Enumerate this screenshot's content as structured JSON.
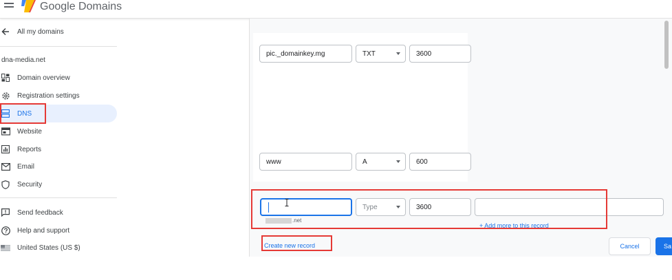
{
  "header": {
    "brand": "Google Domains"
  },
  "sidebar": {
    "back_label": "All my domains",
    "domain": "dna-media.net",
    "items": [
      {
        "label": "Domain overview",
        "icon": "dashboard-icon"
      },
      {
        "label": "Registration settings",
        "icon": "gear-icon"
      },
      {
        "label": "DNS",
        "icon": "dns-icon",
        "active": true
      },
      {
        "label": "Website",
        "icon": "website-icon"
      },
      {
        "label": "Reports",
        "icon": "reports-icon"
      },
      {
        "label": "Email",
        "icon": "email-icon"
      },
      {
        "label": "Security",
        "icon": "shield-icon"
      }
    ],
    "footer": [
      {
        "label": "Send feedback",
        "icon": "feedback-icon"
      },
      {
        "label": "Help and support",
        "icon": "help-icon"
      },
      {
        "label": "United States (US $)",
        "icon": "us-flag-icon"
      }
    ]
  },
  "records": [
    {
      "host": "pic._domainkey.mg",
      "type": "TXT",
      "ttl": "3600"
    },
    {
      "host": "www",
      "type": "A",
      "ttl": "600"
    }
  ],
  "new_record": {
    "host_value": "",
    "type_placeholder": "Type",
    "ttl": "3600",
    "data_value": "",
    "suggestion_suffix": ".net",
    "add_more_label": "+ Add more to this record"
  },
  "actions": {
    "create_new_record": "Create new record",
    "cancel": "Cancel",
    "save": "Sa"
  },
  "colors": {
    "accent": "#1a73e8",
    "highlight": "#e53935",
    "active_bg": "#e8f0fe"
  }
}
